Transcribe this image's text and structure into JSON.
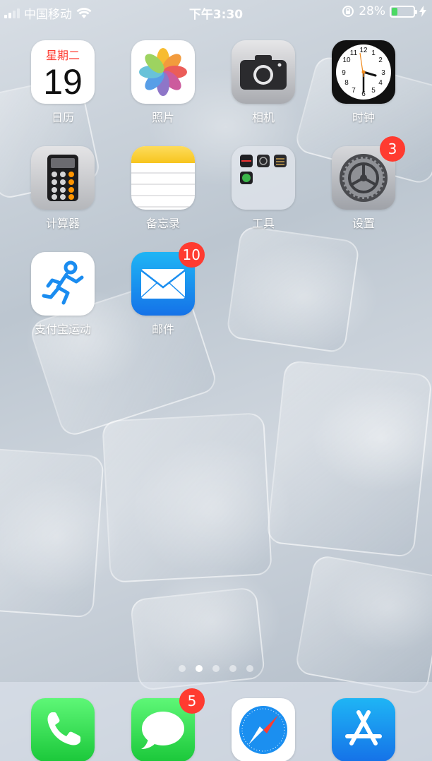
{
  "status_bar": {
    "carrier": "中国移动",
    "time": "下午3:30",
    "battery_percent": "28%",
    "battery_level": 0.28
  },
  "apps": [
    {
      "id": "calendar",
      "label": "日历",
      "weekday": "星期二",
      "day": "19",
      "icon": "calendar-icon"
    },
    {
      "id": "photos",
      "label": "照片",
      "icon": "photos-icon"
    },
    {
      "id": "camera",
      "label": "相机",
      "icon": "camera-icon"
    },
    {
      "id": "clock",
      "label": "时钟",
      "icon": "clock-icon",
      "clock_numbers": [
        "12",
        "1",
        "2",
        "3",
        "4",
        "5",
        "6",
        "7",
        "8",
        "9",
        "10",
        "11"
      ]
    },
    {
      "id": "calculator",
      "label": "计算器",
      "icon": "calculator-icon"
    },
    {
      "id": "notes",
      "label": "备忘录",
      "icon": "notes-icon"
    },
    {
      "id": "tools",
      "label": "工具",
      "icon": "folder-icon"
    },
    {
      "id": "settings",
      "label": "设置",
      "icon": "gear-icon",
      "badge": "3"
    },
    {
      "id": "alipay-sport",
      "label": "支付宝运动",
      "icon": "running-man-icon"
    },
    {
      "id": "mail",
      "label": "邮件",
      "icon": "envelope-icon",
      "badge": "10"
    }
  ],
  "page_dots": {
    "count": 5,
    "active_index": 1
  },
  "dock": [
    {
      "id": "phone",
      "icon": "phone-icon"
    },
    {
      "id": "messages",
      "icon": "message-bubble-icon",
      "badge": "5"
    },
    {
      "id": "safari",
      "icon": "compass-icon"
    },
    {
      "id": "app-store",
      "icon": "app-store-icon"
    }
  ]
}
